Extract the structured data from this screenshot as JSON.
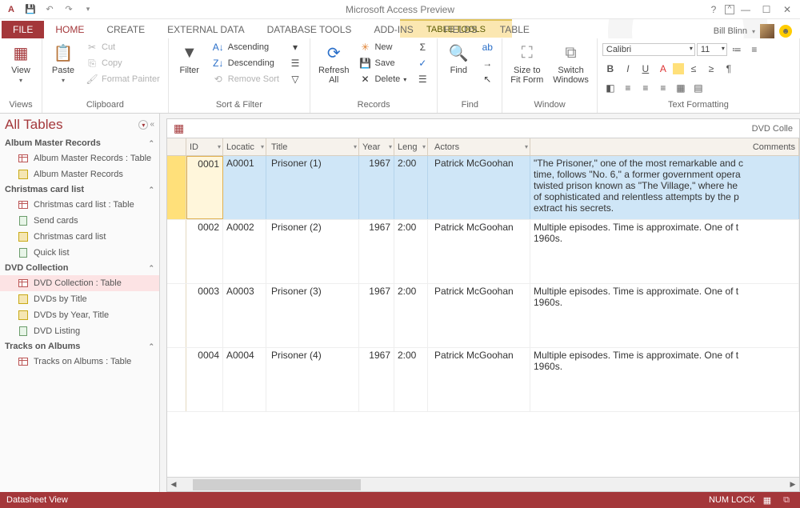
{
  "app": {
    "title": "Microsoft Access Preview",
    "tabletools": "TABLE TOOLS"
  },
  "user": {
    "name": "Bill Blinn"
  },
  "tabs": {
    "file": "FILE",
    "home": "HOME",
    "create": "CREATE",
    "external": "EXTERNAL DATA",
    "dbtools": "DATABASE TOOLS",
    "addins": "ADD-INS",
    "fields": "FIELDS",
    "table": "TABLE"
  },
  "ribbon": {
    "views": {
      "view": "View",
      "label": "Views"
    },
    "clipboard": {
      "paste": "Paste",
      "cut": "Cut",
      "copy": "Copy",
      "painter": "Format Painter",
      "label": "Clipboard"
    },
    "sort": {
      "filter": "Filter",
      "asc": "Ascending",
      "desc": "Descending",
      "remove": "Remove Sort",
      "label": "Sort & Filter"
    },
    "records": {
      "refresh": "Refresh\nAll",
      "new": "New",
      "save": "Save",
      "delete": "Delete",
      "label": "Records"
    },
    "find": {
      "find": "Find",
      "label": "Find"
    },
    "window": {
      "size": "Size to\nFit Form",
      "switch": "Switch\nWindows",
      "label": "Window"
    },
    "fmt": {
      "font": "Calibri",
      "size": "11",
      "label": "Text Formatting"
    }
  },
  "nav": {
    "header": "All Tables",
    "groups": [
      {
        "name": "Album Master Records",
        "items": [
          "Album Master Records : Table",
          "Album Master Records"
        ]
      },
      {
        "name": "Christmas card list",
        "items": [
          "Christmas card list : Table",
          "Send cards",
          "Christmas card list",
          "Quick list"
        ]
      },
      {
        "name": "DVD Collection",
        "items": [
          "DVD Collection : Table",
          "DVDs by Title",
          "DVDs by Year, Title",
          "DVD Listing"
        ]
      },
      {
        "name": "Tracks on Albums",
        "items": [
          "Tracks on Albums : Table"
        ]
      }
    ],
    "selected": "DVD Collection : Table"
  },
  "doc": {
    "title": "DVD Colle"
  },
  "grid": {
    "headers": {
      "id": "ID",
      "loc": "Locatic",
      "title": "Title",
      "year": "Year",
      "len": "Leng",
      "actors": "Actors",
      "comments": "Comments"
    },
    "rows": [
      {
        "id": "0001",
        "loc": "A0001",
        "title": "Prisoner (1)",
        "year": "1967",
        "len": "2:00",
        "actors": "Patrick McGoohan",
        "comments": "\"The Prisoner,\" one of the most remarkable and c time, follows \"No. 6,\" a former government opera twisted prison known as \"The Village,\" where he  of sophisticated and relentless attempts by the p extract his secrets."
      },
      {
        "id": "0002",
        "loc": "A0002",
        "title": "Prisoner (2)",
        "year": "1967",
        "len": "2:00",
        "actors": "Patrick McGoohan",
        "comments": "Multiple episodes. Time is approximate. One of t 1960s."
      },
      {
        "id": "0003",
        "loc": "A0003",
        "title": "Prisoner (3)",
        "year": "1967",
        "len": "2:00",
        "actors": "Patrick McGoohan",
        "comments": "Multiple episodes. Time is approximate. One of t 1960s."
      },
      {
        "id": "0004",
        "loc": "A0004",
        "title": "Prisoner (4)",
        "year": "1967",
        "len": "2:00",
        "actors": "Patrick McGoohan",
        "comments": "Multiple episodes. Time is approximate. One of t 1960s."
      }
    ]
  },
  "status": {
    "view": "Datasheet View",
    "numlock": "NUM LOCK"
  }
}
